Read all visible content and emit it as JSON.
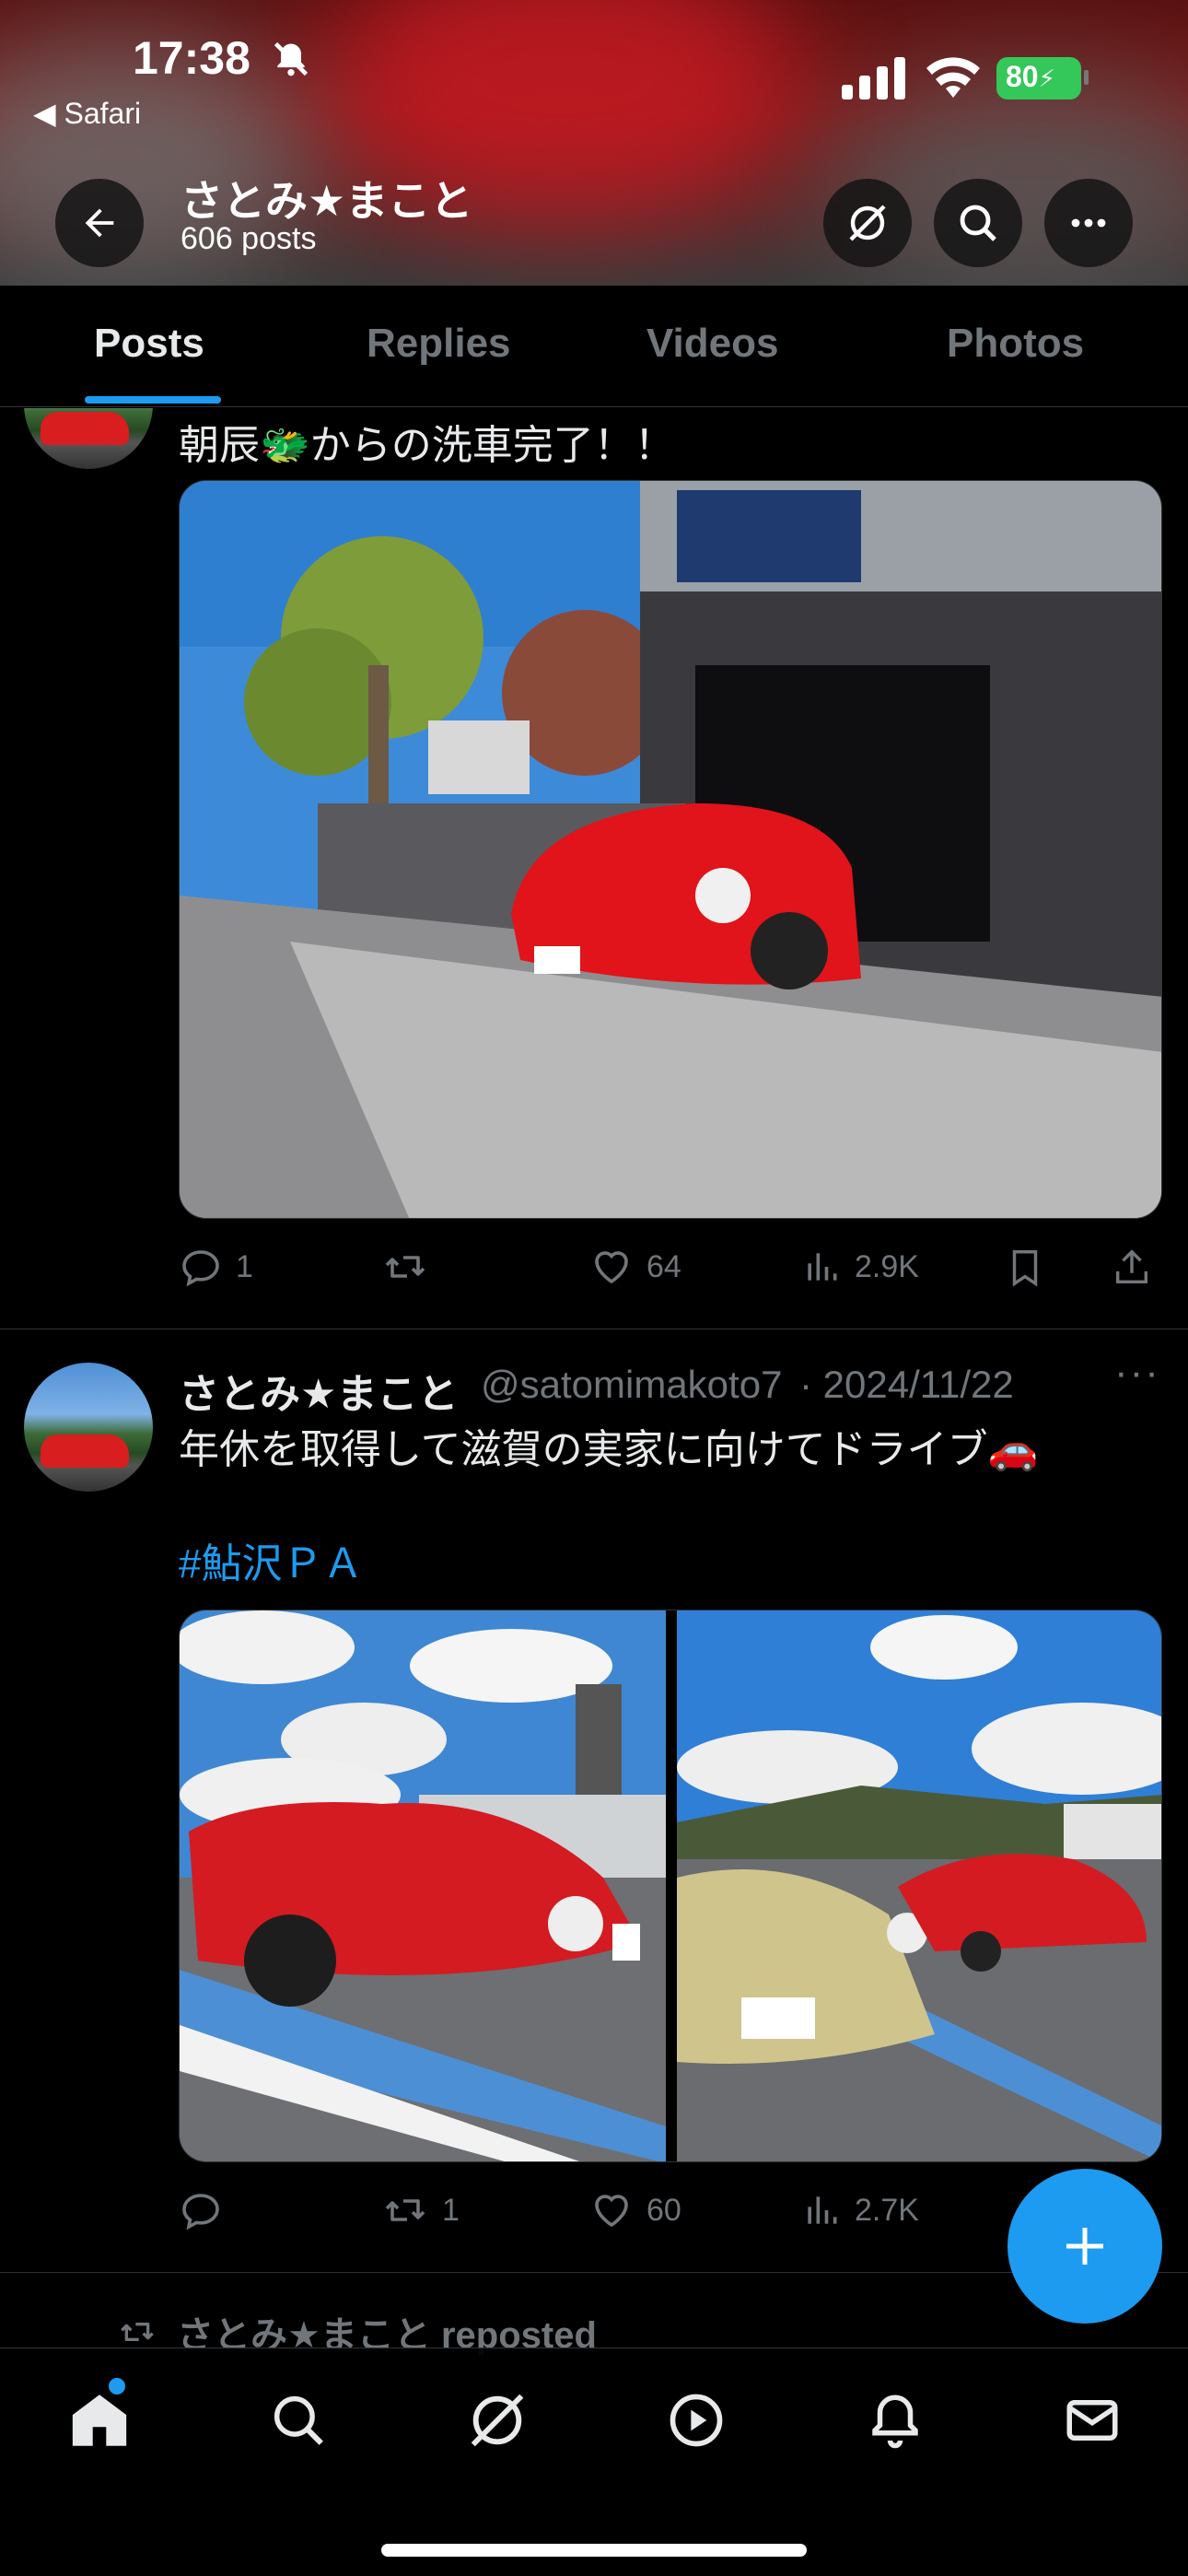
{
  "status_bar": {
    "time": "17:38",
    "back_app": "◀ Safari",
    "battery": "80"
  },
  "header": {
    "name": "さとみ★まこと",
    "posts_count": "606 posts"
  },
  "tabs": [
    {
      "label": "Posts",
      "active": true
    },
    {
      "label": "Replies",
      "active": false
    },
    {
      "label": "Videos",
      "active": false
    },
    {
      "label": "Photos",
      "active": false
    }
  ],
  "post1": {
    "text": "朝辰🐲からの洗車完了！！",
    "actions": {
      "replies": "1",
      "reposts": "",
      "likes": "64",
      "views": "2.9K"
    }
  },
  "post2": {
    "name": "さとみ★まこと",
    "handle": "@satomimakoto7",
    "date": "· 2024/11/22",
    "text": "年休を取得して滋賀の実家に向けてドライブ🚗",
    "hashtag": "#鮎沢ＰＡ",
    "actions": {
      "replies": "",
      "reposts": "1",
      "likes": "60",
      "views": "2.7K"
    }
  },
  "repost_banner": "さとみ★まこと reposted",
  "colors": {
    "accent": "#1d9bf0",
    "background": "#000000",
    "muted": "#71767b"
  },
  "icons": [
    "back-arrow-icon",
    "grok-icon",
    "search-icon",
    "more-icon",
    "reply-icon",
    "repost-icon",
    "like-icon",
    "views-icon",
    "bookmark-icon",
    "share-icon",
    "home-icon",
    "explore-icon",
    "grok-nav-icon",
    "video-icon",
    "bell-icon",
    "mail-icon",
    "compose-plus-icon"
  ]
}
